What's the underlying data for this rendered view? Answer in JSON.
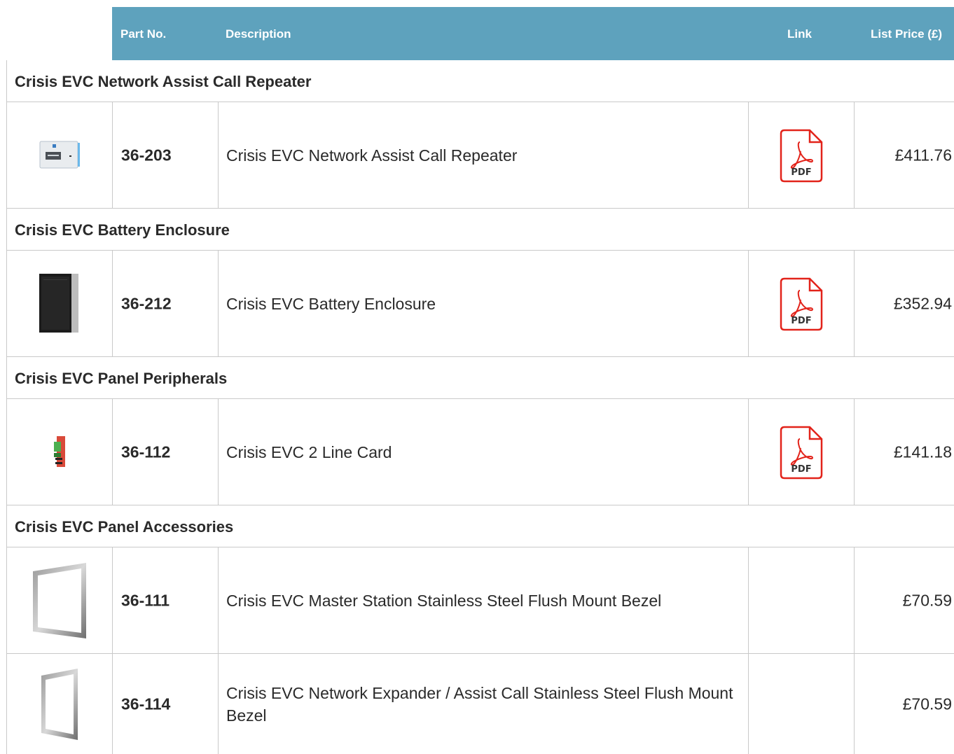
{
  "header": {
    "part_no": "Part No.",
    "description": "Description",
    "link": "Link",
    "list_price": "List Price (£)"
  },
  "sections": [
    {
      "title": "Crisis EVC Network Assist Call Repeater",
      "products": [
        {
          "part_no": "36-203",
          "description": "Crisis EVC Network Assist Call Repeater",
          "price": "£411.76",
          "pdf_label": "PDF",
          "image": "wall-panel-icon"
        }
      ]
    },
    {
      "title": "Crisis EVC Battery Enclosure",
      "products": [
        {
          "part_no": "36-212",
          "description": "Crisis EVC Battery Enclosure",
          "price": "£352.94",
          "pdf_label": "PDF",
          "image": "enclosure-icon"
        }
      ]
    },
    {
      "title": "Crisis EVC Panel Peripherals",
      "products": [
        {
          "part_no": "36-112",
          "description": "Crisis EVC 2 Line Card",
          "price": "£141.18",
          "pdf_label": "PDF",
          "image": "circuit-card-icon"
        }
      ]
    },
    {
      "title": "Crisis EVC Panel Accessories",
      "products": [
        {
          "part_no": "36-111",
          "description": "Crisis EVC Master Station Stainless Steel Flush Mount Bezel",
          "price": "£70.59",
          "image": "bezel-icon"
        },
        {
          "part_no": "36-114",
          "description": "Crisis EVC Network Expander / Assist Call Stainless Steel Flush Mount Bezel",
          "price": "£70.59",
          "image": "bezel-icon"
        }
      ]
    }
  ],
  "colors": {
    "header_bg": "#5ea2bd",
    "header_text": "#ffffff",
    "border": "#c9c9c9",
    "pdf_red": "#e2231a"
  }
}
